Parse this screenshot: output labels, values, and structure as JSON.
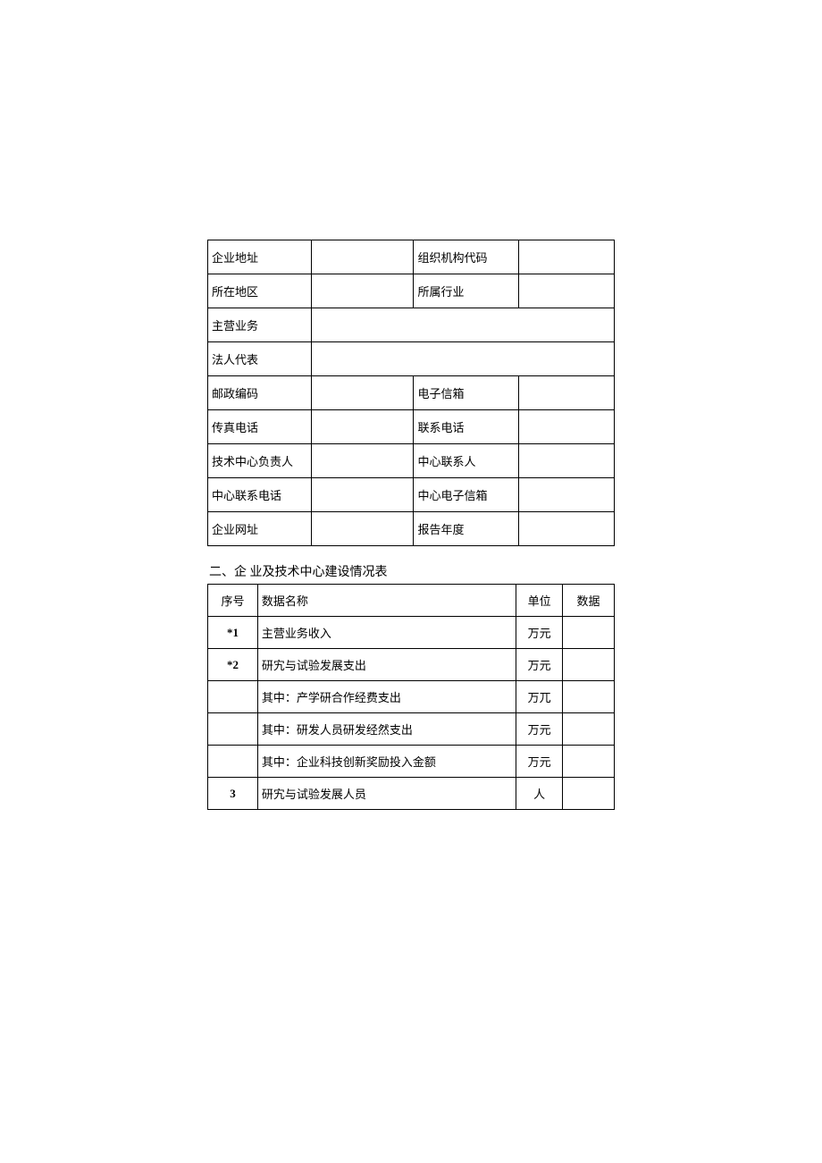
{
  "table1": {
    "rows": [
      {
        "label1": "企业地址",
        "value1": "",
        "label2": "组织机构代码",
        "value2": ""
      },
      {
        "label1": "所在地区",
        "value1": "",
        "label2": "所属行业",
        "value2": ""
      },
      {
        "label1": "主营业务",
        "value1": "",
        "span": true
      },
      {
        "label1": "法人代表",
        "value1": "",
        "span": true
      },
      {
        "label1": "邮政编码",
        "value1": "",
        "label2": "电子信箱",
        "value2": ""
      },
      {
        "label1": "传真电话",
        "value1": "",
        "label2": "联系电话",
        "value2": ""
      },
      {
        "label1": "技术中心负责人",
        "value1": "",
        "label2": "中心联系人",
        "value2": ""
      },
      {
        "label1": "中心联系电话",
        "value1": "",
        "label2": "中心电子信箱",
        "value2": ""
      },
      {
        "label1": "企业网址",
        "value1": "",
        "label2": "报告年度",
        "value2": ""
      }
    ]
  },
  "section2_title": "二、企 业及技术中心建设情况表",
  "table2": {
    "header": {
      "num": "序号",
      "name": "数据名称",
      "unit": "单位",
      "data": "数据"
    },
    "rows": [
      {
        "num": "*1",
        "name": "主营业务收入",
        "unit": "万元",
        "data": "",
        "bold": true
      },
      {
        "num": "*2",
        "name": "研宄与试验发展支出",
        "unit": "万元",
        "data": "",
        "bold": true
      },
      {
        "num": "",
        "name": "其中：产学研合作经费支出",
        "unit": "万兀",
        "data": ""
      },
      {
        "num": "",
        "name": "其中：研发人员研发经然支出",
        "unit": "万元",
        "data": ""
      },
      {
        "num": "",
        "name": "其中：企业科技创新奖励投入金额",
        "unit": "万元",
        "data": ""
      },
      {
        "num": "3",
        "name": "研宄与试验发展人员",
        "unit": "人",
        "data": "",
        "bold": true
      }
    ]
  }
}
